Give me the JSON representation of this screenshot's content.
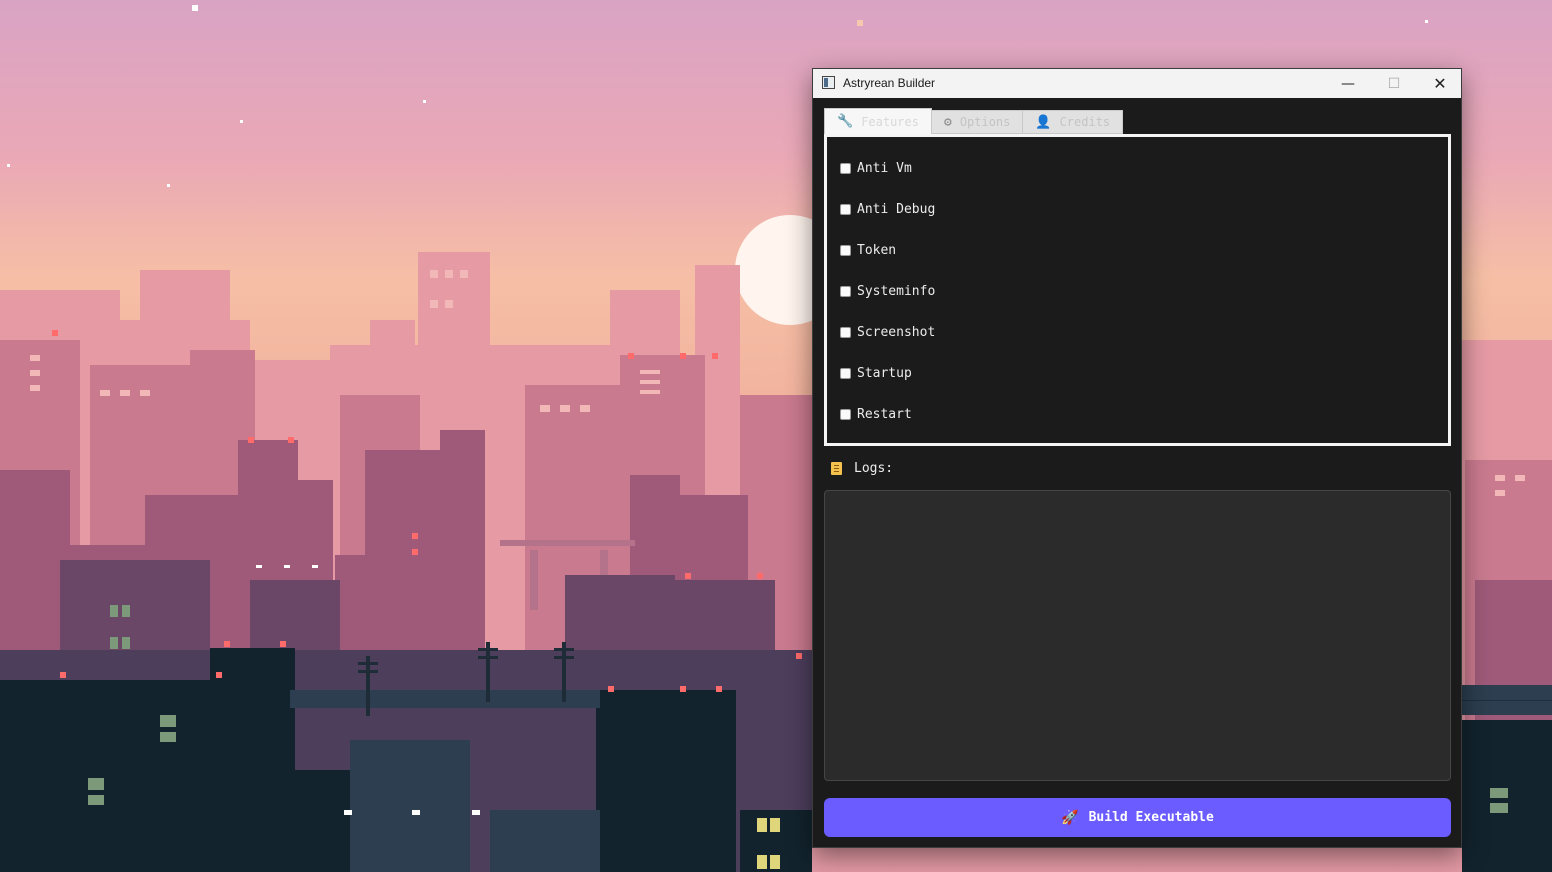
{
  "window": {
    "title": "Astryrean Builder",
    "controls": {
      "minimize": "—",
      "maximize": "☐",
      "close": "✕"
    }
  },
  "tabs": [
    {
      "label": "Features",
      "icon": "wrench-icon",
      "active": true
    },
    {
      "label": "Options",
      "icon": "gear-icon",
      "active": false
    },
    {
      "label": "Credits",
      "icon": "person-icon",
      "active": false
    }
  ],
  "features": [
    {
      "label": "Anti Vm",
      "checked": false
    },
    {
      "label": "Anti Debug",
      "checked": false
    },
    {
      "label": "Token",
      "checked": false
    },
    {
      "label": "Systeminfo",
      "checked": false
    },
    {
      "label": "Screenshot",
      "checked": false
    },
    {
      "label": "Startup",
      "checked": false
    },
    {
      "label": "Restart",
      "checked": false
    }
  ],
  "logs": {
    "label": "Logs:",
    "icon": "notepad-icon",
    "content": ""
  },
  "build": {
    "label": "Build Executable",
    "icon": "rocket-icon",
    "color": "#6a5cff"
  }
}
